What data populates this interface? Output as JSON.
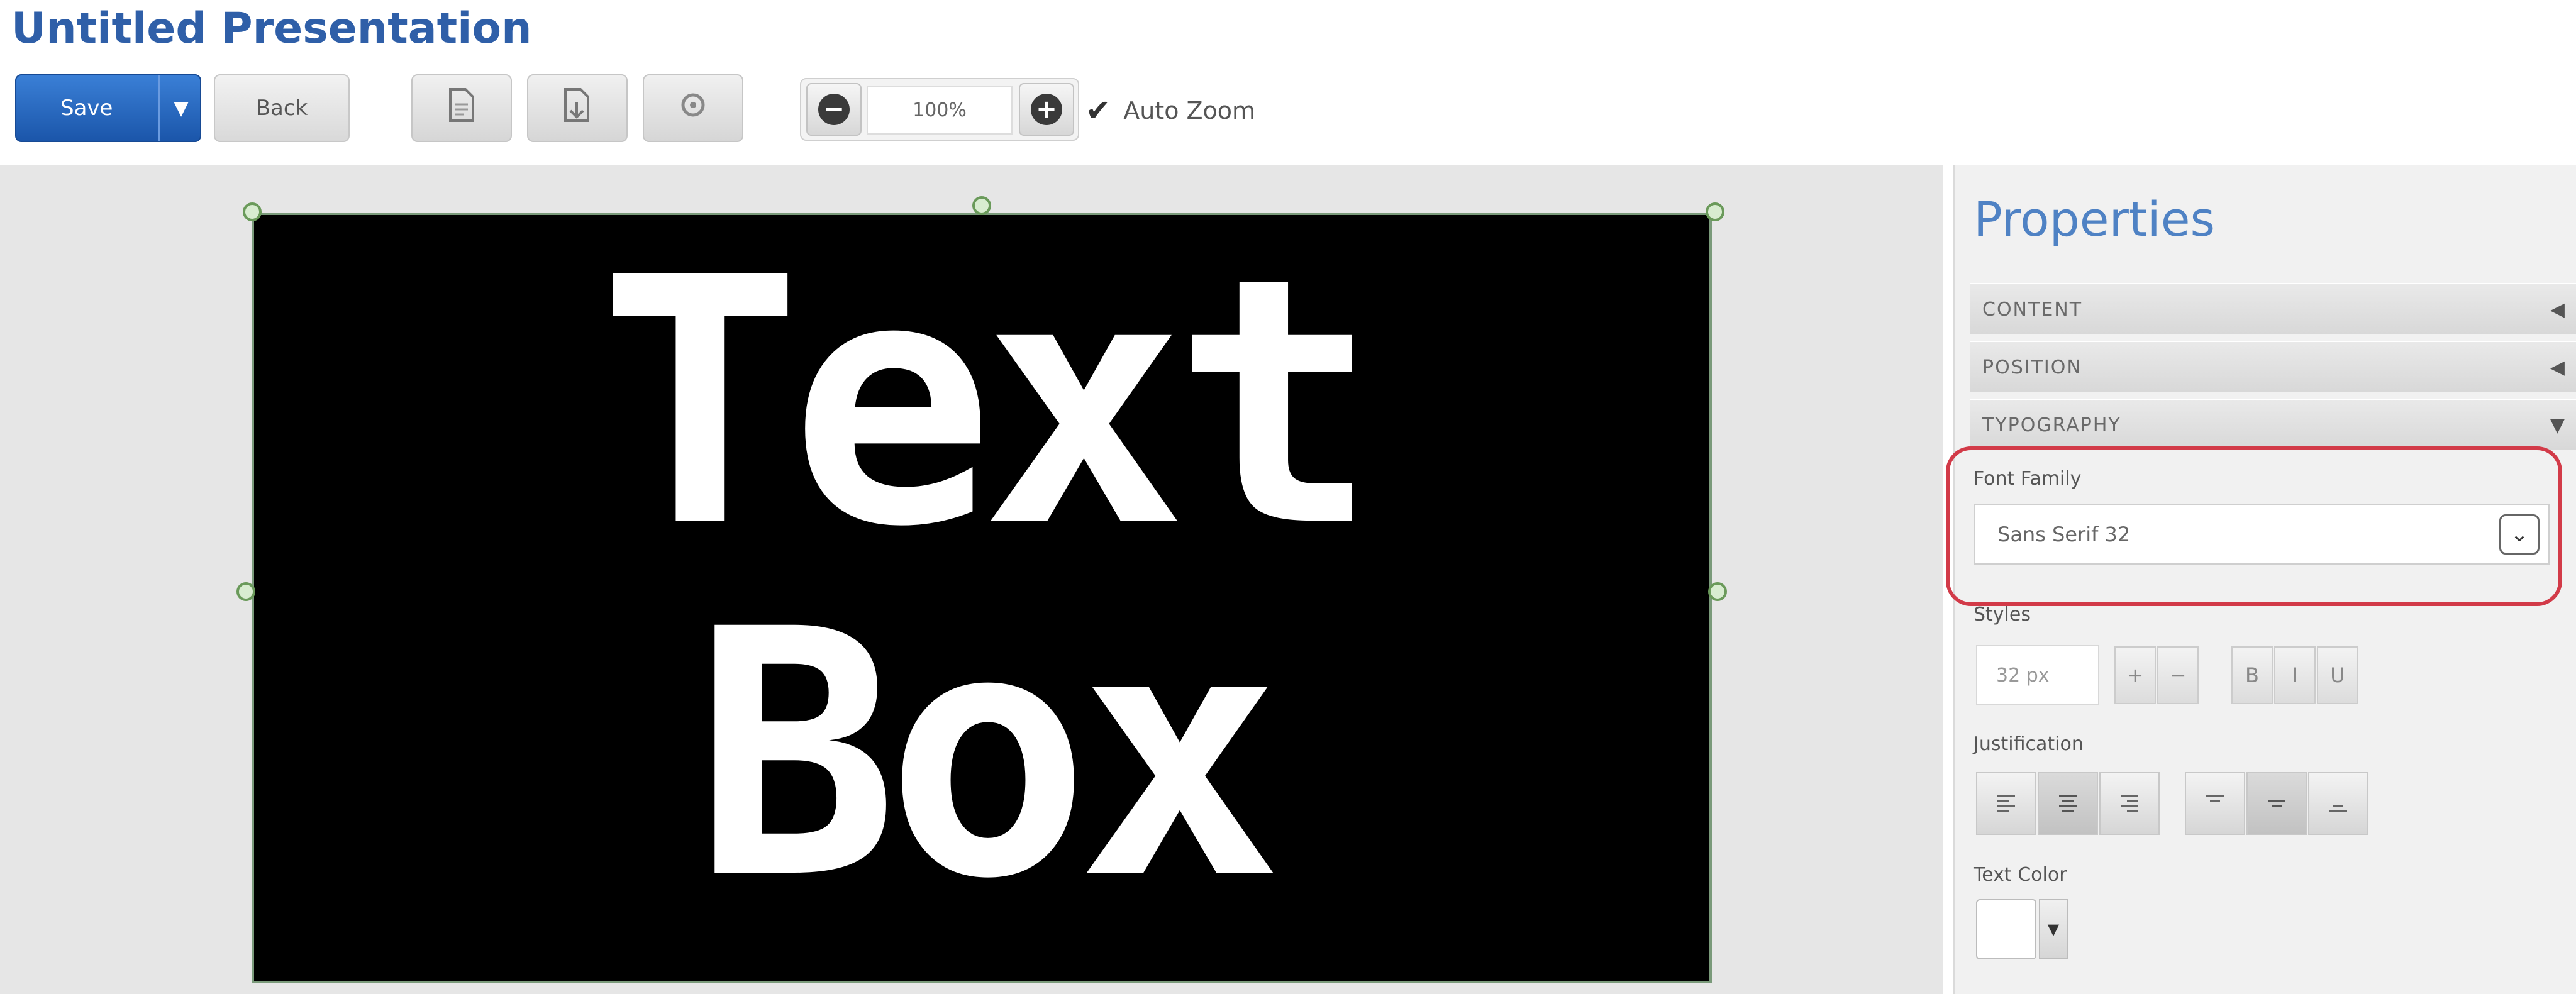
{
  "app": {
    "title": "Untitled Presentation"
  },
  "toolbar": {
    "save_label": "Save",
    "save_caret": "▼",
    "back_label": "Back",
    "icon_buttons": [
      "document-icon",
      "export-icon",
      "settings-icon"
    ],
    "zoom": {
      "value": "100%",
      "auto_zoom_label": "Auto Zoom",
      "auto_zoom_checked": true
    }
  },
  "slide": {
    "text": "Text\nBox",
    "background": "#000000",
    "text_color": "#ffffff"
  },
  "properties": {
    "title": "Properties",
    "sections": [
      {
        "label": "CONTENT",
        "arrow": "◀"
      },
      {
        "label": "POSITION",
        "arrow": "◀"
      },
      {
        "label": "TYPOGRAPHY",
        "arrow": "▼"
      }
    ],
    "font_family_label": "Font Family",
    "font_family_value": "Sans Serif 32",
    "styles_label": "Styles",
    "size_value": "32 px",
    "justification_label": "Justification",
    "text_color_label": "Text Color",
    "text_color_value": "#ffffff"
  },
  "colors": {
    "accent": "#2f5fa8",
    "highlight": "#d23a48",
    "save_button": "#1b56aa"
  }
}
